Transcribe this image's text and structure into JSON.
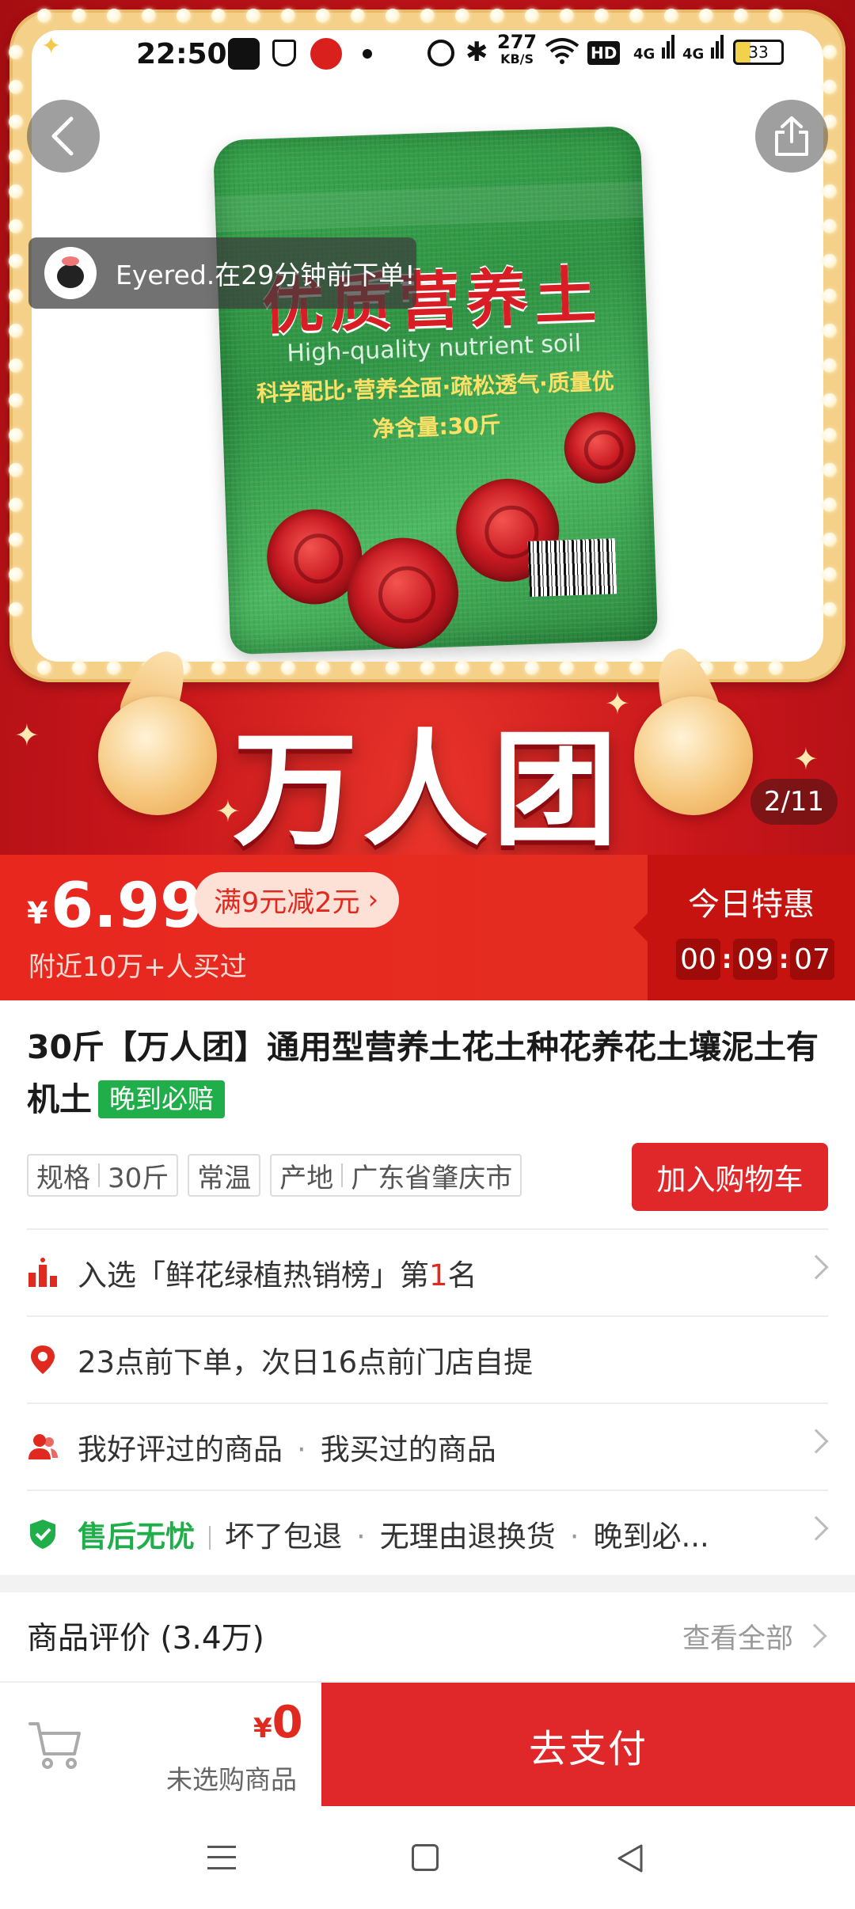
{
  "status_bar": {
    "time": "22:50",
    "net_speed": "277",
    "net_unit": "KB/S",
    "hd": "HD",
    "sig1": "4G",
    "sig2": "4G",
    "battery": "33"
  },
  "hero": {
    "bag_title": "优质营养土",
    "bag_subtitle": "High-quality nutrient soil",
    "bag_features": "科学配比·营养全面·疏松透气·质量优",
    "bag_net": "净含量:30斤",
    "banner": "万人团",
    "pager": "2/11",
    "ticker": "Eyered.在29分钟前下单!",
    "icons": [
      "back-icon",
      "share-icon"
    ]
  },
  "price": {
    "currency": "¥",
    "value": "6.99",
    "coupon": "满9元减2元",
    "sold": "附近10万+人买过",
    "deal_title": "今日特惠",
    "timer": [
      "00",
      "09",
      "07"
    ]
  },
  "product": {
    "title": "30斤【万人团】通用型营养土花土种花养花土壤泥土有机土",
    "late_tag": "晚到必赔",
    "spec_label": "规格",
    "spec_value": "30斤",
    "storage": "常温",
    "origin_label": "产地",
    "origin_value": "广东省肇庆市",
    "add_cart": "加入购物车"
  },
  "rows": {
    "rank_pre": "入选「鲜花绿植热销榜」第",
    "rank_num": "1",
    "rank_post": "名",
    "delivery": "23点前下单，次日16点前门店自提",
    "reviewed": "我好评过的商品",
    "bought": "我买过的商品",
    "service_title": "售后无忧",
    "service_1": "坏了包退",
    "service_2": "无理由退换货",
    "service_3": "晚到必..."
  },
  "reviews": {
    "title": "商品评价 (3.4万)",
    "view_all": "查看全部"
  },
  "checkout": {
    "currency": "¥",
    "amount": "0",
    "none_selected": "未选购商品",
    "pay": "去支付"
  },
  "colors": {
    "brand_red": "#e0282a",
    "deal_red": "#c7130f",
    "green": "#1fae4a"
  }
}
